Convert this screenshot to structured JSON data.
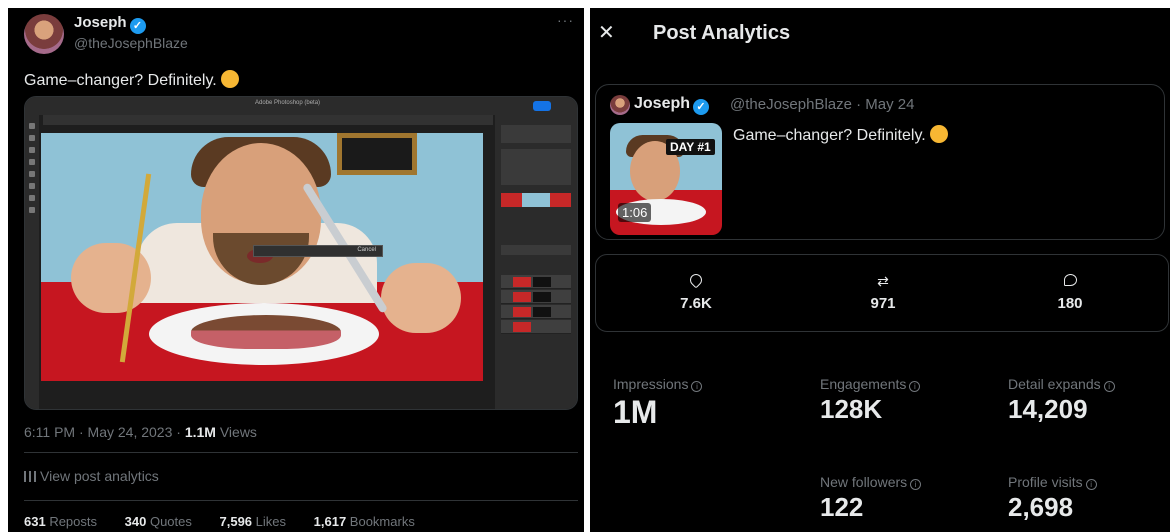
{
  "left": {
    "author": {
      "name": "Joseph",
      "handle": "@theJosephBlaze"
    },
    "tweet_text": "Game–changer? Definitely.",
    "photoshop_window_title": "Adobe Photoshop (beta)",
    "dialog_button": "Cancel",
    "meta": {
      "time": "6:11 PM · May 24, 2023 · ",
      "views_value": "1.1M",
      "views_label": " Views"
    },
    "analytics_link": "View post analytics",
    "counts": {
      "reposts": "631",
      "reposts_label": " Reposts",
      "quotes": "340",
      "quotes_label": " Quotes",
      "likes": "7,596",
      "likes_label": " Likes",
      "bookmarks": "1,617",
      "bookmarks_label": " Bookmarks"
    }
  },
  "right": {
    "title": "Post Analytics",
    "card": {
      "name": "Joseph",
      "handle_date": "@theJosephBlaze · May 24",
      "text": "Game–changer? Definitely.",
      "thumb_badge": "DAY #1",
      "thumb_duration": "1:06"
    },
    "engagement": {
      "likes": "7.6K",
      "reposts": "971",
      "replies": "180"
    },
    "metrics": {
      "impressions": {
        "label": "Impressions",
        "value": "1M"
      },
      "engagements": {
        "label": "Engagements",
        "value": "128K"
      },
      "detail_expands": {
        "label": "Detail expands",
        "value": "14,209"
      },
      "new_followers": {
        "label": "New followers",
        "value": "122"
      },
      "profile_visits": {
        "label": "Profile visits",
        "value": "2,698"
      }
    }
  },
  "colors": {
    "background": "#000000",
    "text": "#e7e9ea",
    "muted": "#71767b",
    "border": "#2f3336",
    "verified": "#1d9bf0"
  }
}
